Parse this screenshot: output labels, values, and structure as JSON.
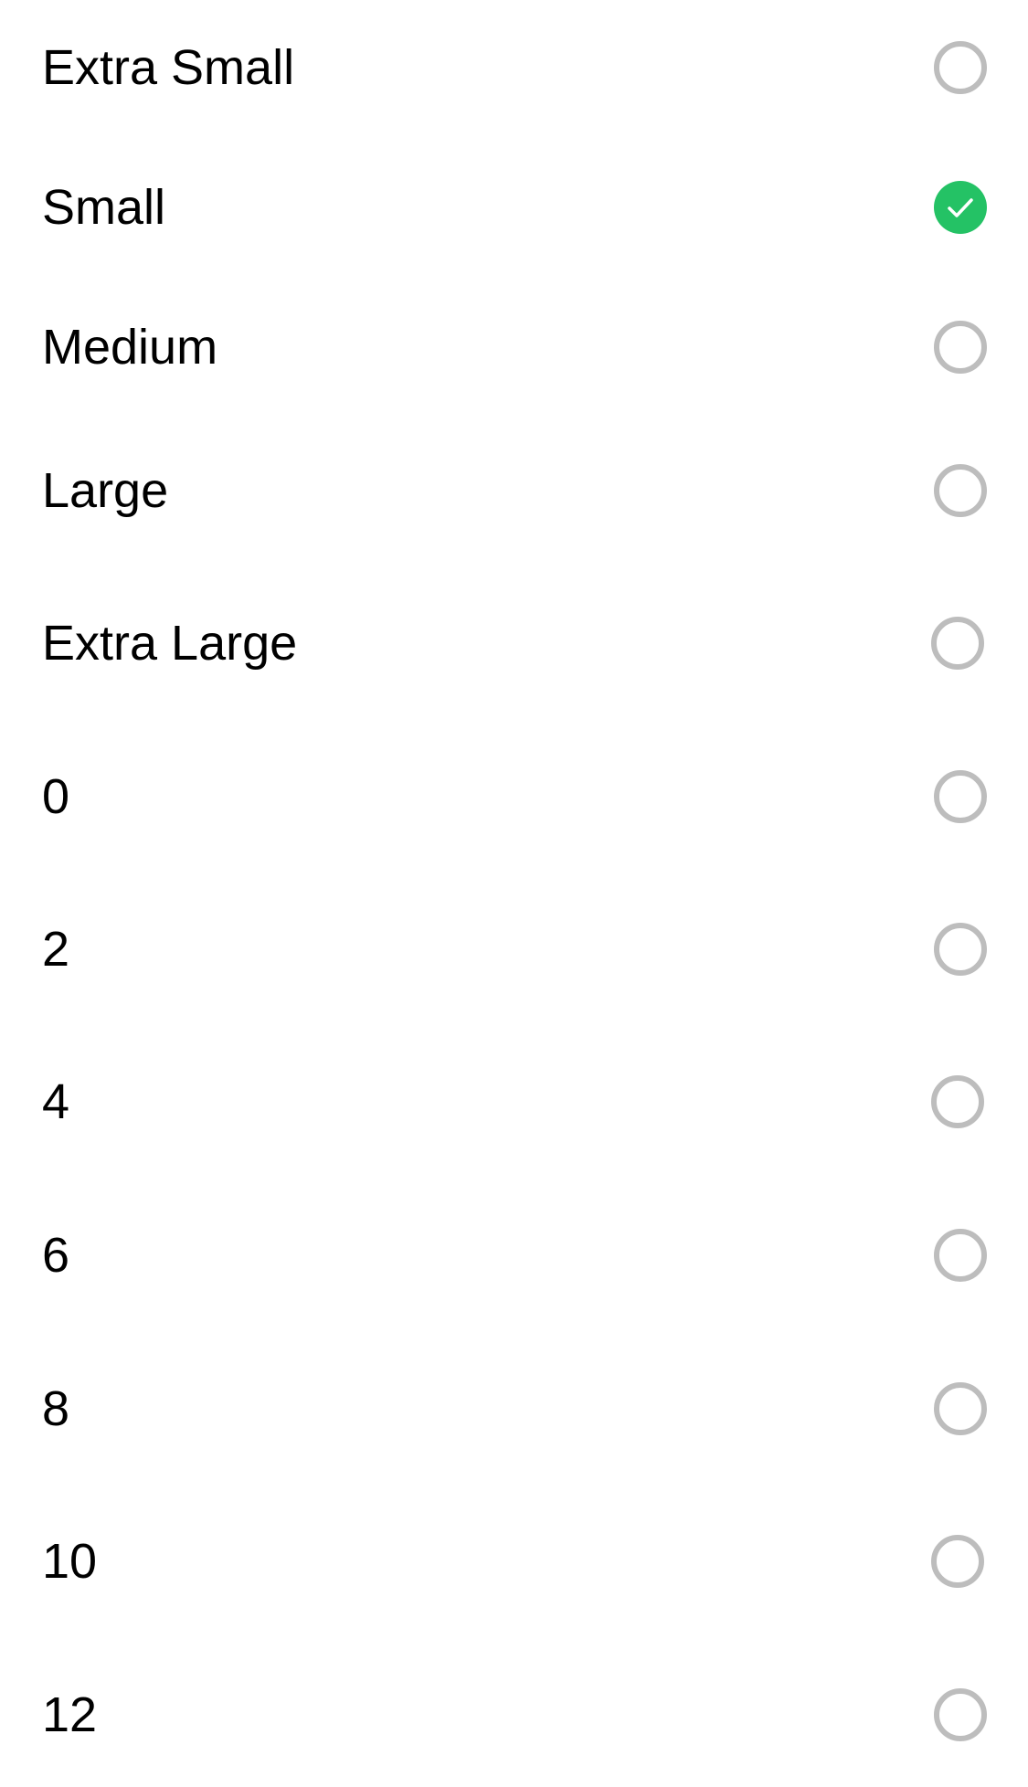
{
  "size_options": {
    "selected_value": "Small",
    "colors": {
      "selected_fill": "#24c265",
      "unselected_ring": "#bdbdbd",
      "label_text": "#000000"
    },
    "items": [
      {
        "label": "Extra Small",
        "selected": false,
        "icon": "radio-unselected-icon"
      },
      {
        "label": "Small",
        "selected": true,
        "icon": "radio-checked-icon"
      },
      {
        "label": "Medium",
        "selected": false,
        "icon": "radio-unselected-icon"
      },
      {
        "label": "Large",
        "selected": false,
        "icon": "radio-unselected-icon"
      },
      {
        "label": "Extra Large",
        "selected": false,
        "icon": "radio-unselected-icon"
      },
      {
        "label": "0",
        "selected": false,
        "icon": "radio-unselected-icon"
      },
      {
        "label": "2",
        "selected": false,
        "icon": "radio-unselected-icon"
      },
      {
        "label": "4",
        "selected": false,
        "icon": "radio-unselected-icon"
      },
      {
        "label": "6",
        "selected": false,
        "icon": "radio-unselected-icon"
      },
      {
        "label": "8",
        "selected": false,
        "icon": "radio-unselected-icon"
      },
      {
        "label": "10",
        "selected": false,
        "icon": "radio-unselected-icon"
      },
      {
        "label": "12",
        "selected": false,
        "icon": "radio-unselected-icon"
      }
    ]
  }
}
